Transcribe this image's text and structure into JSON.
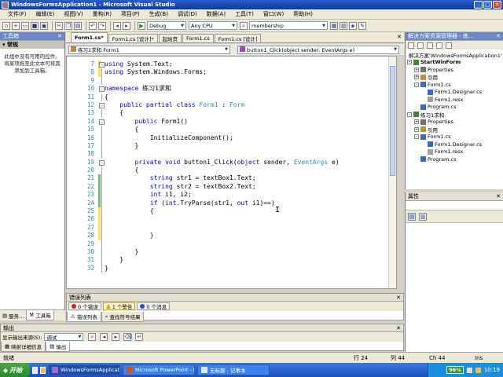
{
  "window": {
    "title": "WindowsFormsApplication1 - Microsoft Visual Studio",
    "min": "_",
    "max": "□",
    "close": "✕"
  },
  "menu": [
    "文件(F)",
    "编辑(E)",
    "视图(V)",
    "重构(R)",
    "项目(P)",
    "生成(B)",
    "调试(D)",
    "数据(A)",
    "工具(T)",
    "窗口(W)",
    "帮助(H)"
  ],
  "toolbar": {
    "config": "Debug",
    "platform": "Any CPU",
    "find": "membership"
  },
  "toolbox": {
    "title": "工具箱",
    "pin": "✕",
    "group": "常规",
    "message": "此组中没有可用的控件。将某项拖至此文本可将其添加到工具箱。",
    "tabs": [
      "服务...",
      "工具箱"
    ]
  },
  "doc_tabs": [
    "Form1.cs*",
    "Form1.cs [设计]*",
    "起始页",
    "Form1.cs",
    "Form1.cs [设计]"
  ],
  "doc_close": "✕",
  "nav": {
    "left": "练习1求和.Form1",
    "right": "button1_Click(object sender, EventArgs e)"
  },
  "editor": {
    "line_numbers": [
      "7",
      "8",
      "9",
      "10",
      "11",
      "12",
      "13",
      "14",
      "15",
      "16",
      "17",
      "18",
      "19",
      "20",
      "21",
      "22",
      "23",
      "24",
      "25",
      "26",
      "27",
      "28",
      "29",
      "30",
      "31",
      "32"
    ],
    "outline_markers": [
      "-",
      "",
      "",
      "-",
      "",
      "-",
      "",
      "-",
      "",
      "",
      "",
      "",
      "-",
      "",
      "",
      "",
      "",
      "",
      "",
      "",
      "",
      "",
      "",
      "",
      "",
      ""
    ],
    "change_markers": [
      "yellow",
      "yellow",
      "",
      "",
      "",
      "",
      "",
      "",
      "",
      "",
      "",
      "",
      "",
      "",
      "green",
      "green",
      "green",
      "green",
      "yellow",
      "yellow",
      "yellow",
      "yellow",
      "",
      "",
      "",
      ""
    ],
    "lines": [
      [
        {
          "k": "kw",
          "t": "using"
        },
        {
          "k": "",
          "t": " System.Text;"
        }
      ],
      [
        {
          "k": "kw",
          "t": "using"
        },
        {
          "k": "",
          "t": " System.Windows.Forms;"
        }
      ],
      [],
      [
        {
          "k": "kw",
          "t": "namespace"
        },
        {
          "k": "",
          "t": " 练习1求和"
        }
      ],
      [
        {
          "k": "",
          "t": "{"
        }
      ],
      [
        {
          "k": "",
          "t": "    "
        },
        {
          "k": "kw",
          "t": "public partial class"
        },
        {
          "k": "",
          "t": " "
        },
        {
          "k": "ty",
          "t": "Form1"
        },
        {
          "k": "",
          "t": " : "
        },
        {
          "k": "ty",
          "t": "Form"
        }
      ],
      [
        {
          "k": "",
          "t": "    {"
        }
      ],
      [
        {
          "k": "",
          "t": "        "
        },
        {
          "k": "kw",
          "t": "public"
        },
        {
          "k": "",
          "t": " Form1()"
        }
      ],
      [
        {
          "k": "",
          "t": "        {"
        }
      ],
      [
        {
          "k": "",
          "t": "            InitializeComponent();"
        }
      ],
      [
        {
          "k": "",
          "t": "        }"
        }
      ],
      [],
      [
        {
          "k": "",
          "t": "        "
        },
        {
          "k": "kw",
          "t": "private void"
        },
        {
          "k": "",
          "t": " button1_Click("
        },
        {
          "k": "kw",
          "t": "object"
        },
        {
          "k": "",
          "t": " sender, "
        },
        {
          "k": "ty",
          "t": "EventArgs"
        },
        {
          "k": "",
          "t": " e)"
        }
      ],
      [
        {
          "k": "",
          "t": "        {"
        }
      ],
      [
        {
          "k": "",
          "t": "            "
        },
        {
          "k": "kw",
          "t": "string"
        },
        {
          "k": "",
          "t": " str1 = textBox1.Text;"
        }
      ],
      [
        {
          "k": "",
          "t": "            "
        },
        {
          "k": "kw",
          "t": "string"
        },
        {
          "k": "",
          "t": " str2 = textBox2.Text;"
        }
      ],
      [
        {
          "k": "",
          "t": "            "
        },
        {
          "k": "kw",
          "t": "int"
        },
        {
          "k": "",
          "t": " i1, i2;"
        }
      ],
      [
        {
          "k": "",
          "t": "            "
        },
        {
          "k": "kw",
          "t": "if"
        },
        {
          "k": "",
          "t": " ("
        },
        {
          "k": "kw",
          "t": "int"
        },
        {
          "k": "",
          "t": ".TryParse(str1, "
        },
        {
          "k": "kw",
          "t": "out"
        },
        {
          "k": "",
          "t": " i1)=="
        },
        {
          "k": "",
          "t": ")"
        }
      ],
      [
        {
          "k": "",
          "t": "            {"
        }
      ],
      [],
      [],
      [
        {
          "k": "",
          "t": "            }"
        }
      ],
      [],
      [
        {
          "k": "",
          "t": "        }"
        }
      ],
      [
        {
          "k": "",
          "t": "    }"
        }
      ],
      [
        {
          "k": "",
          "t": "}"
        }
      ]
    ]
  },
  "error_list": {
    "title": "错误列表",
    "errors": "0 个错误",
    "warnings": "1 个警告",
    "messages": "0 个消息",
    "tabs": [
      "错误列表",
      "查找符号结果"
    ]
  },
  "output": {
    "title": "输出",
    "source_label": "显示输出来源(S):",
    "source_value": "调试",
    "tabs": [
      "映射详细信息",
      "输出"
    ]
  },
  "solution": {
    "title": "解决方案资源管理器 - 练...",
    "items": [
      {
        "level": 0,
        "exp": "",
        "label": "解决方案'WindowsFormsApplication1'",
        "icon": "#6a6ab0",
        "bold": false
      },
      {
        "level": 0,
        "exp": "-",
        "label": "StartWinForm",
        "icon": "#3a8a3a",
        "bold": true
      },
      {
        "level": 1,
        "exp": "+",
        "label": "Properties",
        "icon": "#707070",
        "bold": false
      },
      {
        "level": 1,
        "exp": "+",
        "label": "引用",
        "icon": "#c09030",
        "bold": false
      },
      {
        "level": 1,
        "exp": "-",
        "label": "Form1.cs",
        "icon": "#3a6ac0",
        "bold": false
      },
      {
        "level": 2,
        "exp": "",
        "label": "Form1.Designer.cs",
        "icon": "#3a6ac0",
        "bold": false
      },
      {
        "level": 2,
        "exp": "",
        "label": "Form1.resx",
        "icon": "#a0a0a0",
        "bold": false
      },
      {
        "level": 1,
        "exp": "",
        "label": "Program.cs",
        "icon": "#3a6ac0",
        "bold": false
      },
      {
        "level": 0,
        "exp": "-",
        "label": "练习1求和",
        "icon": "#3a8a3a",
        "bold": false
      },
      {
        "level": 1,
        "exp": "+",
        "label": "Properties",
        "icon": "#707070",
        "bold": false
      },
      {
        "level": 1,
        "exp": "+",
        "label": "引用",
        "icon": "#c09030",
        "bold": false
      },
      {
        "level": 1,
        "exp": "-",
        "label": "Form1.cs",
        "icon": "#3a6ac0",
        "bold": false
      },
      {
        "level": 2,
        "exp": "",
        "label": "Form1.Designer.cs",
        "icon": "#3a6ac0",
        "bold": false
      },
      {
        "level": 2,
        "exp": "",
        "label": "Form1.resx",
        "icon": "#a0a0a0",
        "bold": false
      },
      {
        "level": 1,
        "exp": "",
        "label": "Program.cs",
        "icon": "#3a6ac0",
        "bold": false
      }
    ]
  },
  "properties": {
    "title": "属性"
  },
  "status": {
    "ready": "就绪",
    "line": "行 24",
    "col": "列 44",
    "ch": "Ch 44",
    "ins": "Ins"
  },
  "taskbar": {
    "start": "开始",
    "tasks": [
      "WindowsFormsApplicatio...",
      "Microsoft PowerPoint - [...",
      "无标题 - 记事本"
    ],
    "cpu": "96%",
    "time": "10:19"
  },
  "colors": {
    "keyword": "#0000ff",
    "type": "#2b91af",
    "title_bar": "#0a3aa0"
  }
}
